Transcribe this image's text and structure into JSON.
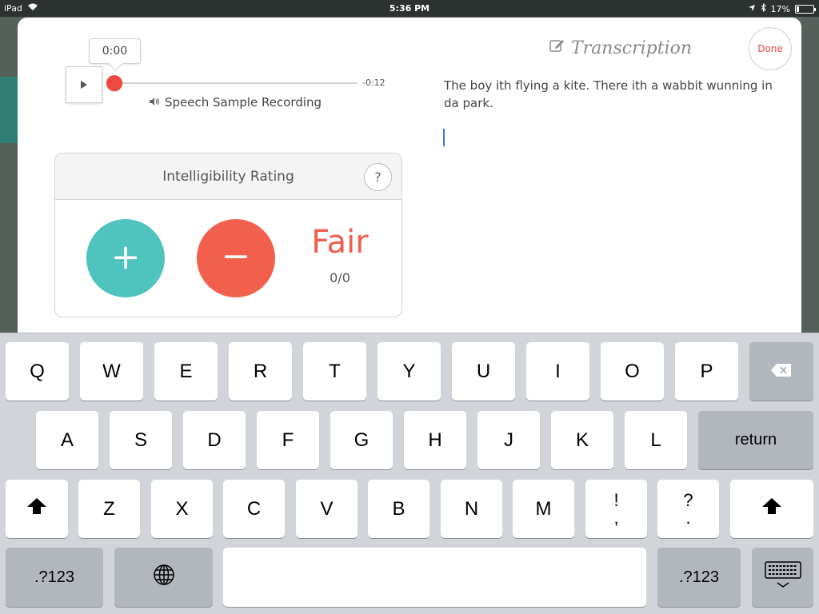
{
  "status_bar": {
    "device": "iPad",
    "time": "5:36 PM",
    "battery": "17%",
    "battery_level": 0.17
  },
  "player": {
    "current_time": "0:00",
    "remaining_time": "-0:12",
    "label": "Speech Sample Recording",
    "progress": 0
  },
  "rating": {
    "title": "Intelligibility Rating",
    "help_label": "?",
    "plus_label": "+",
    "minus_label": "−",
    "value": "Fair",
    "count": "0/0"
  },
  "transcription": {
    "title": "Transcription",
    "done_label": "Done",
    "text": "The boy ith flying a kite. There ith a wabbit wunning in da park."
  },
  "keyboard": {
    "row1": [
      "Q",
      "W",
      "E",
      "R",
      "T",
      "Y",
      "U",
      "I",
      "O",
      "P"
    ],
    "row2": [
      "A",
      "S",
      "D",
      "F",
      "G",
      "H",
      "J",
      "K",
      "L"
    ],
    "row3": [
      "Z",
      "X",
      "C",
      "V",
      "B",
      "N",
      "M"
    ],
    "punct1": [
      "!",
      ","
    ],
    "punct2": [
      "?",
      "."
    ],
    "return_label": "return",
    "numbers_label": ".?123"
  },
  "colors": {
    "accent_red": "#ee4a41",
    "plus_teal": "#4fc3bd",
    "minus_red": "#f2604d"
  }
}
